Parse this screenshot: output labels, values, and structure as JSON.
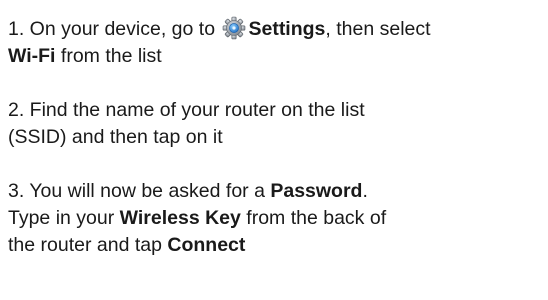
{
  "steps": [
    {
      "line1": {
        "pre": "1. On your device, go to",
        "icon": "settings-gear-icon",
        "bold": "Settings",
        "post": ", then select"
      },
      "line2": {
        "bold": "Wi-Fi",
        "post": " from the list"
      }
    },
    {
      "line1": "2. Find the name of your router on the list",
      "line2": "(SSID) and then tap on it"
    },
    {
      "line1": {
        "pre": "3. You will now be asked for a ",
        "bold": "Password",
        "post": "."
      },
      "line2": {
        "pre": "Type in your ",
        "bold": "Wireless Key",
        "post": " from the back of"
      },
      "line3": {
        "pre": "the router and tap ",
        "bold": "Connect"
      }
    }
  ],
  "colors": {
    "text": "#1a1a1a",
    "icon_blue": "#2e7fd0",
    "icon_grey": "#8a8f96"
  }
}
